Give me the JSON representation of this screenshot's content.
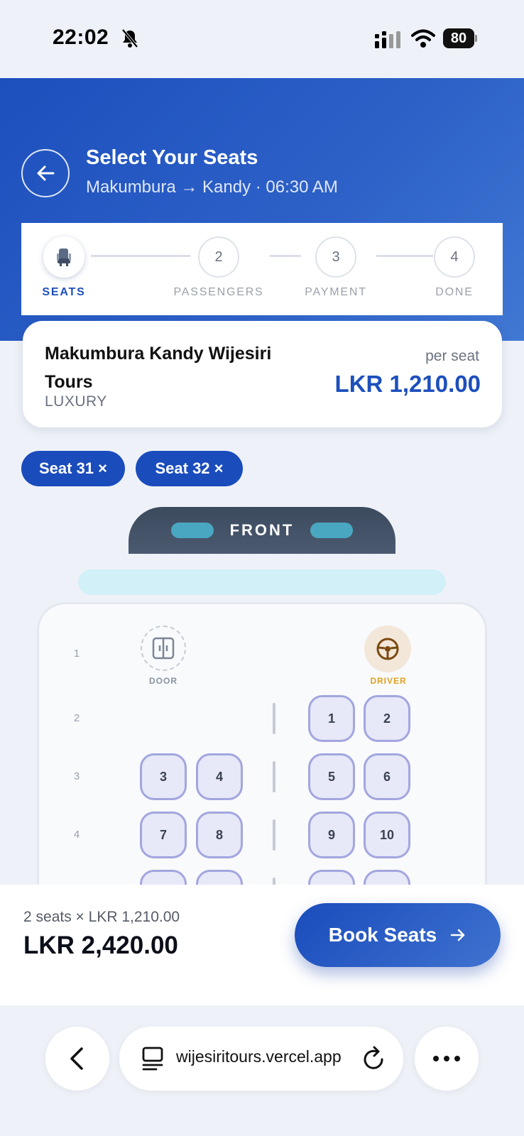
{
  "status_bar": {
    "time": "22:02",
    "battery": "80"
  },
  "header": {
    "title": "Select Your Seats",
    "route": "Makumbura → Kandy · 06:30 AM"
  },
  "stepper": {
    "steps": [
      {
        "number": "1",
        "label": "SEATS",
        "active": true,
        "icon": "seat-icon"
      },
      {
        "number": "2",
        "label": "PASSENGERS",
        "active": false
      },
      {
        "number": "3",
        "label": "PAYMENT",
        "active": false
      },
      {
        "number": "4",
        "label": "DONE",
        "active": false
      }
    ]
  },
  "operator": {
    "name": "Makumbura Kandy Wijesiri Tours",
    "class": "LUXURY",
    "per_seat_label": "per seat",
    "price": "LKR 1,210.00"
  },
  "selected_seats": [
    {
      "label": "Seat 31 ×"
    },
    {
      "label": "Seat 32 ×"
    }
  ],
  "bus": {
    "front_label": "FRONT",
    "door_label": "DOOR",
    "driver_label": "DRIVER",
    "rows": [
      "1",
      "2",
      "3",
      "4"
    ],
    "seats": [
      {
        "number": "1"
      },
      {
        "number": "2"
      },
      {
        "number": "3"
      },
      {
        "number": "4"
      },
      {
        "number": "5"
      },
      {
        "number": "6"
      },
      {
        "number": "7"
      },
      {
        "number": "8"
      },
      {
        "number": "9"
      },
      {
        "number": "10"
      }
    ]
  },
  "summary": {
    "line": "2 seats × LKR 1,210.00",
    "total": "LKR 2,420.00",
    "book_label": "Book Seats"
  },
  "browser": {
    "url": "wijesiritours.vercel.app"
  },
  "colors": {
    "primary": "#1d4fbd",
    "seat_fill": "#e7e8f8",
    "seat_border": "#a3a6de",
    "driver_accent": "#e0a020"
  }
}
